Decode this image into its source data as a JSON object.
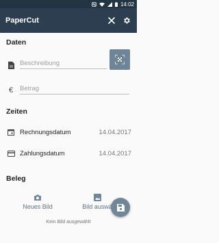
{
  "status_bar": {
    "time": "14:02",
    "icons": [
      "nfc-icon",
      "wifi-icon",
      "signal-icon",
      "battery-icon"
    ]
  },
  "app_bar": {
    "title": "PaperCut",
    "icons": [
      "close-icon",
      "gear-icon"
    ]
  },
  "daten": {
    "title": "Daten",
    "description_placeholder": "Beschreibung",
    "amount_placeholder": "Betrag"
  },
  "zeiten": {
    "title": "Zeiten",
    "invoice_date_label": "Rechnungsdatum",
    "invoice_date_value": "14.04.2017",
    "payment_date_label": "Zahlungsdatum",
    "payment_date_value": "14.04.2017"
  },
  "beleg": {
    "title": "Beleg",
    "new_image_label": "Neues Bild",
    "choose_image_label": "Bild auswä",
    "no_image_text": "Kein Bild ausgewählt"
  },
  "colors": {
    "app_bar": "#2c3e50",
    "status_bar": "#233443",
    "accent": "#6f8797"
  }
}
